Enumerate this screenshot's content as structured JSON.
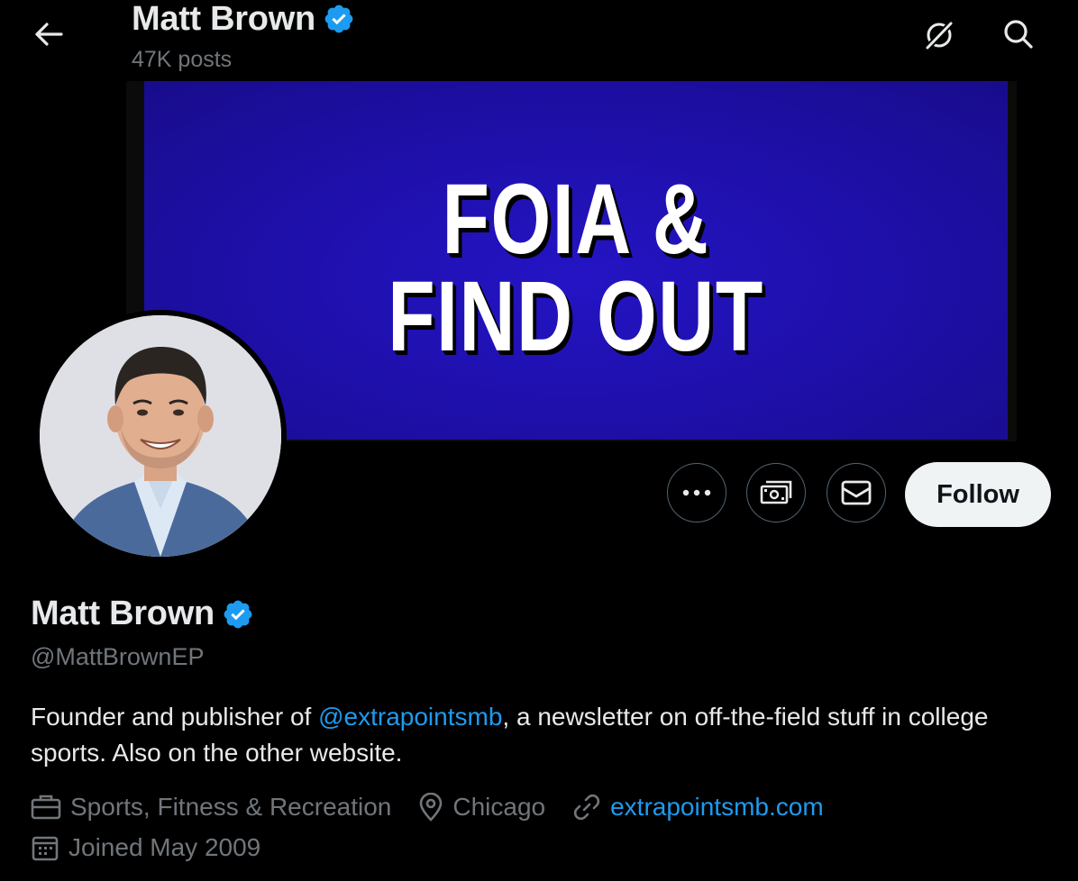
{
  "header": {
    "name": "Matt Brown",
    "posts": "47K posts",
    "back_icon": "arrow-left-icon",
    "grok_icon": "grok-icon",
    "search_icon": "search-icon"
  },
  "banner": {
    "line1": "FOIA &",
    "line2": "FIND OUT",
    "bg_color": "#2414c4"
  },
  "actions": {
    "more_icon": "more-icon",
    "tip_icon": "money-icon",
    "message_icon": "envelope-icon",
    "follow_label": "Follow"
  },
  "profile": {
    "name": "Matt Brown",
    "handle": "@MattBrownEP",
    "bio_prefix": "Founder and publisher of ",
    "bio_mention": "@extrapointsmb",
    "bio_suffix": ", a newsletter on off-the-field stuff in college sports. Also on the other website.",
    "category": "Sports, Fitness & Recreation",
    "location": "Chicago",
    "website": "extrapointsmb.com",
    "joined": "Joined May 2009"
  },
  "colors": {
    "background": "#000000",
    "text_primary": "#e7e9ea",
    "text_secondary": "#71767b",
    "accent": "#1d9bf0",
    "verified": "#1d9bf0"
  }
}
